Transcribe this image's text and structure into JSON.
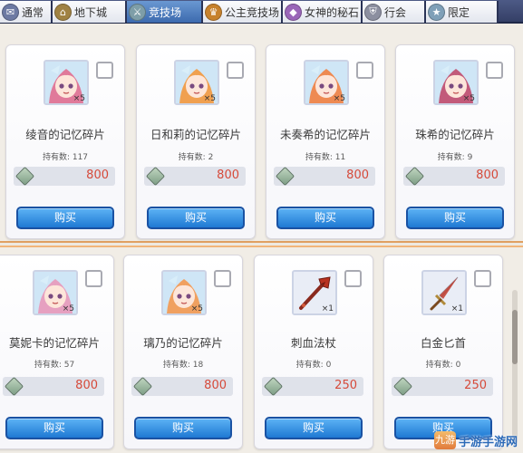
{
  "tabs": [
    {
      "label": "通常",
      "icon": "bag-icon",
      "icon_color": "#6d7aa3",
      "active": false
    },
    {
      "label": "地下城",
      "icon": "dungeon-icon",
      "icon_color": "#a08243",
      "active": false
    },
    {
      "label": "竞技场",
      "icon": "arena-icon",
      "icon_color": "#7e9ea8",
      "active": true
    },
    {
      "label": "公主竞技场",
      "icon": "princess-arena-icon",
      "icon_color": "#c7822d",
      "active": false
    },
    {
      "label": "女神的秘石",
      "icon": "goddess-stone-icon",
      "icon_color": "#9a66b8",
      "active": false
    },
    {
      "label": "行会",
      "icon": "guild-icon",
      "icon_color": "#8c8fa0",
      "active": false
    },
    {
      "label": "限定",
      "icon": "limited-icon",
      "icon_color": "#7fa0b8",
      "active": false
    }
  ],
  "owned_prefix": "持有数:",
  "buy_label": "购买",
  "top_row": [
    {
      "name": "绫音的记忆碎片",
      "owned": "117",
      "price": "800",
      "qty": "×5",
      "kind": "memory",
      "hair": "#e07a9a"
    },
    {
      "name": "日和莉的记忆碎片",
      "owned": "2",
      "price": "800",
      "qty": "×5",
      "kind": "memory",
      "hair": "#f0a050"
    },
    {
      "name": "未奏希的记忆碎片",
      "owned": "11",
      "price": "800",
      "qty": "×5",
      "kind": "memory",
      "hair": "#ee8a52"
    },
    {
      "name": "珠希的记忆碎片",
      "owned": "9",
      "price": "800",
      "qty": "×5",
      "kind": "memory",
      "hair": "#c25a7a"
    }
  ],
  "bottom_row": [
    {
      "name": "莫妮卡的记忆碎片",
      "owned": "57",
      "price": "800",
      "qty": "×5",
      "kind": "memory",
      "hair": "#e6a0c0"
    },
    {
      "name": "璃乃的记忆碎片",
      "owned": "18",
      "price": "800",
      "qty": "×5",
      "kind": "memory",
      "hair": "#f0a060"
    },
    {
      "name": "刺血法杖",
      "owned": "0",
      "price": "250",
      "qty": "×1",
      "kind": "staff",
      "hair": "#c0392b"
    },
    {
      "name": "白金匕首",
      "owned": "0",
      "price": "250",
      "qty": "×1",
      "kind": "dagger",
      "hair": "#c0392b"
    }
  ],
  "watermark": {
    "logo": "九游",
    "text": "手游手游网"
  }
}
